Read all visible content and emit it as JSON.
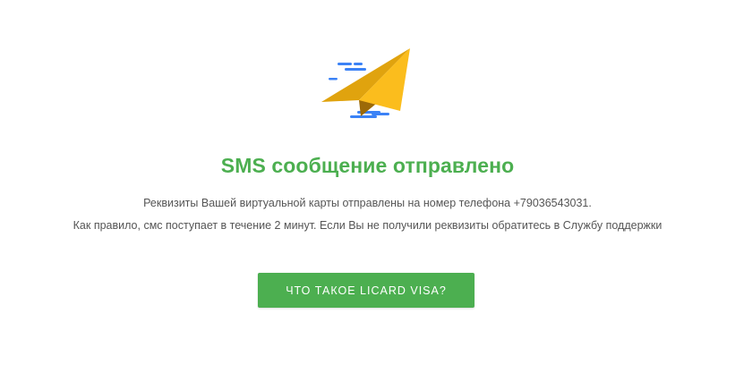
{
  "icon": "paper-plane-icon",
  "colors": {
    "accent": "#4caf50",
    "plane_light": "#fbbd1d",
    "plane_dark": "#e0a30e",
    "plane_shadow": "#b27a0a",
    "speed_lines": "#3b82f6"
  },
  "message": {
    "title": "SMS сообщение отправлено",
    "line1": "Реквизиты Вашей виртуальной карты отправлены на номер телефона +79036543031.",
    "line2": "Как правило, смс поступает в течение 2 минут. Если Вы не получили реквизиты обратитесь в Службу поддержки"
  },
  "cta": {
    "label": "ЧТО ТАКОЕ LICARD VISA?"
  }
}
